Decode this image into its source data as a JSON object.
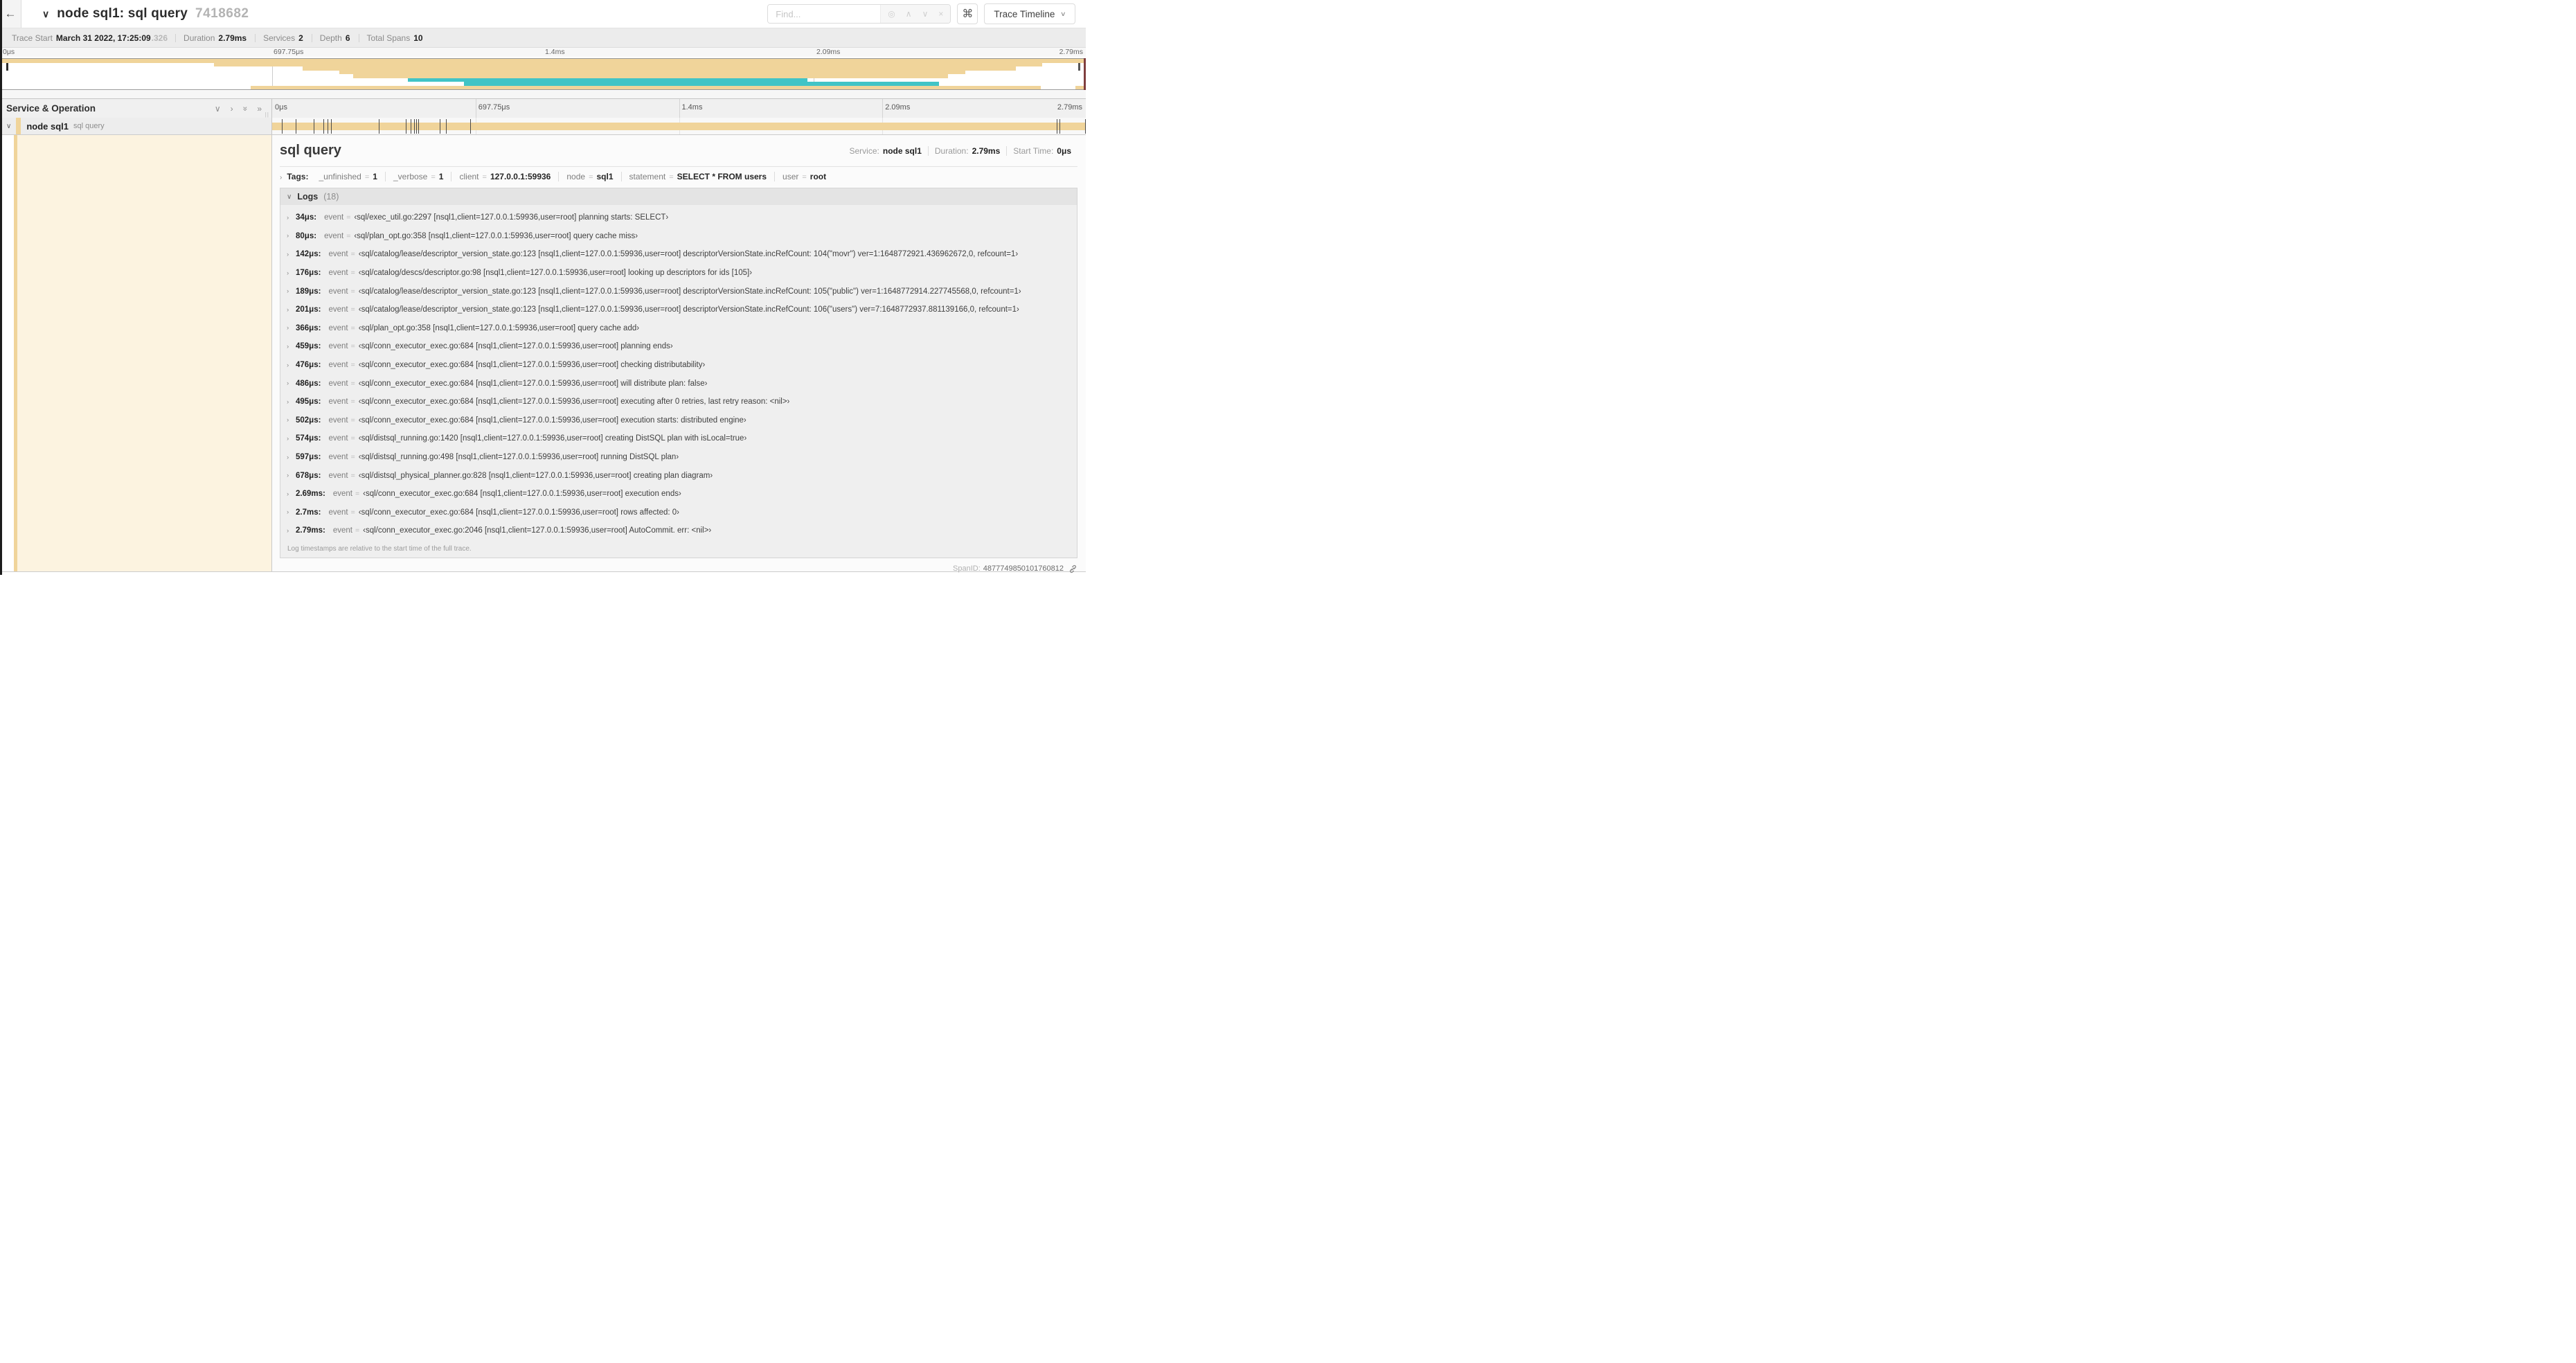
{
  "colors": {
    "tan": "#F0D49A",
    "teal": "#41C4C6",
    "cream": "#FCF3E0",
    "scrub": "#7F3F3F"
  },
  "icons": {
    "back": "←",
    "window_chevron": "∨",
    "chevron_down": "∨",
    "chevron_right": "›",
    "double_chevron_right": "»",
    "find_target": "◎",
    "find_prev": "∧",
    "find_next": "∨",
    "find_clear": "×",
    "command": "⌘",
    "grip": "||"
  },
  "header": {
    "title": "node sql1: sql query",
    "trace_id": "7418682",
    "find_placeholder": "Find...",
    "view_selector": "Trace Timeline"
  },
  "summary": {
    "items": [
      {
        "label": "Trace Start",
        "value": "March 31 2022, 17:25:09",
        "extra": ".326"
      },
      {
        "label": "Duration",
        "value": "2.79ms"
      },
      {
        "label": "Services",
        "value": "2"
      },
      {
        "label": "Depth",
        "value": "6"
      },
      {
        "label": "Total Spans",
        "value": "10"
      }
    ]
  },
  "time_ticks": [
    "0μs",
    "697.75μs",
    "1.4ms",
    "2.09ms",
    "2.79ms"
  ],
  "minimap": {
    "bars": [
      {
        "row": 0,
        "start": 0.0,
        "end": 1.0,
        "color": "tan"
      },
      {
        "row": 1,
        "start": 0.196,
        "end": 0.961,
        "color": "tan"
      },
      {
        "row": 2,
        "start": 0.278,
        "end": 0.937,
        "color": "tan"
      },
      {
        "row": 3,
        "start": 0.312,
        "end": 0.89,
        "color": "tan"
      },
      {
        "row": 4,
        "start": 0.325,
        "end": 0.874,
        "color": "tan"
      },
      {
        "row": 5,
        "start": 0.375,
        "end": 0.744,
        "color": "teal"
      },
      {
        "row": 6,
        "start": 0.427,
        "end": 0.866,
        "color": "teal"
      },
      {
        "row": 7,
        "start": 0.23,
        "end": 0.96,
        "color": "tan"
      },
      {
        "row": 7,
        "start": 0.992,
        "end": 1.0,
        "color": "tan"
      }
    ]
  },
  "timeline": {
    "header": "Service & Operation",
    "row": {
      "service": "node sql1",
      "operation": "sql query",
      "bar": {
        "start": 0.0,
        "end": 1.0
      },
      "log_markers": [
        0.0122,
        0.0287,
        0.0509,
        0.0631,
        0.0677,
        0.072,
        0.1312,
        0.1645,
        0.1706,
        0.1742,
        0.1774,
        0.1799,
        0.2057,
        0.214,
        0.243,
        0.9642,
        0.9677,
        0.9989
      ]
    }
  },
  "detail": {
    "operation": "sql query",
    "eq": "=",
    "meta": [
      {
        "label": "Service:",
        "value": "node sql1"
      },
      {
        "label": "Duration:",
        "value": "2.79ms"
      },
      {
        "label": "Start Time:",
        "value": "0μs"
      }
    ],
    "tags_label": "Tags:",
    "tags": [
      {
        "key": "_unfinished",
        "value": "1"
      },
      {
        "key": "_verbose",
        "value": "1"
      },
      {
        "key": "client",
        "value": "127.0.0.1:59936"
      },
      {
        "key": "node",
        "value": "sql1"
      },
      {
        "key": "statement",
        "value": "SELECT * FROM users"
      },
      {
        "key": "user",
        "value": "root"
      }
    ],
    "logs_label": "Logs",
    "logs_count": "(18)",
    "logs": [
      {
        "time": "34μs:",
        "field": "event",
        "value": "‹sql/exec_util.go:2297 [nsql1,client=127.0.0.1:59936,user=root] planning starts: SELECT›"
      },
      {
        "time": "80μs:",
        "field": "event",
        "value": "‹sql/plan_opt.go:358 [nsql1,client=127.0.0.1:59936,user=root] query cache miss›"
      },
      {
        "time": "142μs:",
        "field": "event",
        "value": "‹sql/catalog/lease/descriptor_version_state.go:123 [nsql1,client=127.0.0.1:59936,user=root] descriptorVersionState.incRefCount: 104(\"movr\") ver=1:1648772921.436962672,0, refcount=1›"
      },
      {
        "time": "176μs:",
        "field": "event",
        "value": "‹sql/catalog/descs/descriptor.go:98 [nsql1,client=127.0.0.1:59936,user=root] looking up descriptors for ids [105]›"
      },
      {
        "time": "189μs:",
        "field": "event",
        "value": "‹sql/catalog/lease/descriptor_version_state.go:123 [nsql1,client=127.0.0.1:59936,user=root] descriptorVersionState.incRefCount: 105(\"public\") ver=1:1648772914.227745568,0, refcount=1›"
      },
      {
        "time": "201μs:",
        "field": "event",
        "value": "‹sql/catalog/lease/descriptor_version_state.go:123 [nsql1,client=127.0.0.1:59936,user=root] descriptorVersionState.incRefCount: 106(\"users\") ver=7:1648772937.881139166,0, refcount=1›"
      },
      {
        "time": "366μs:",
        "field": "event",
        "value": "‹sql/plan_opt.go:358 [nsql1,client=127.0.0.1:59936,user=root] query cache add›"
      },
      {
        "time": "459μs:",
        "field": "event",
        "value": "‹sql/conn_executor_exec.go:684 [nsql1,client=127.0.0.1:59936,user=root] planning ends›"
      },
      {
        "time": "476μs:",
        "field": "event",
        "value": "‹sql/conn_executor_exec.go:684 [nsql1,client=127.0.0.1:59936,user=root] checking distributability›"
      },
      {
        "time": "486μs:",
        "field": "event",
        "value": "‹sql/conn_executor_exec.go:684 [nsql1,client=127.0.0.1:59936,user=root] will distribute plan: false›"
      },
      {
        "time": "495μs:",
        "field": "event",
        "value": "‹sql/conn_executor_exec.go:684 [nsql1,client=127.0.0.1:59936,user=root] executing after 0 retries, last retry reason: <nil>›"
      },
      {
        "time": "502μs:",
        "field": "event",
        "value": "‹sql/conn_executor_exec.go:684 [nsql1,client=127.0.0.1:59936,user=root] execution starts: distributed engine›"
      },
      {
        "time": "574μs:",
        "field": "event",
        "value": "‹sql/distsql_running.go:1420 [nsql1,client=127.0.0.1:59936,user=root] creating DistSQL plan with isLocal=true›"
      },
      {
        "time": "597μs:",
        "field": "event",
        "value": "‹sql/distsql_running.go:498 [nsql1,client=127.0.0.1:59936,user=root] running DistSQL plan›"
      },
      {
        "time": "678μs:",
        "field": "event",
        "value": "‹sql/distsql_physical_planner.go:828 [nsql1,client=127.0.0.1:59936,user=root] creating plan diagram›"
      },
      {
        "time": "2.69ms:",
        "field": "event",
        "value": "‹sql/conn_executor_exec.go:684 [nsql1,client=127.0.0.1:59936,user=root] execution ends›"
      },
      {
        "time": "2.7ms:",
        "field": "event",
        "value": "‹sql/conn_executor_exec.go:684 [nsql1,client=127.0.0.1:59936,user=root] rows affected: 0›"
      },
      {
        "time": "2.79ms:",
        "field": "event",
        "value": "‹sql/conn_executor_exec.go:2046 [nsql1,client=127.0.0.1:59936,user=root] AutoCommit. err: <nil>›"
      }
    ],
    "footnote": "Log timestamps are relative to the start time of the full trace.",
    "span_id_label": "SpanID:",
    "span_id": "4877749850101760812"
  }
}
